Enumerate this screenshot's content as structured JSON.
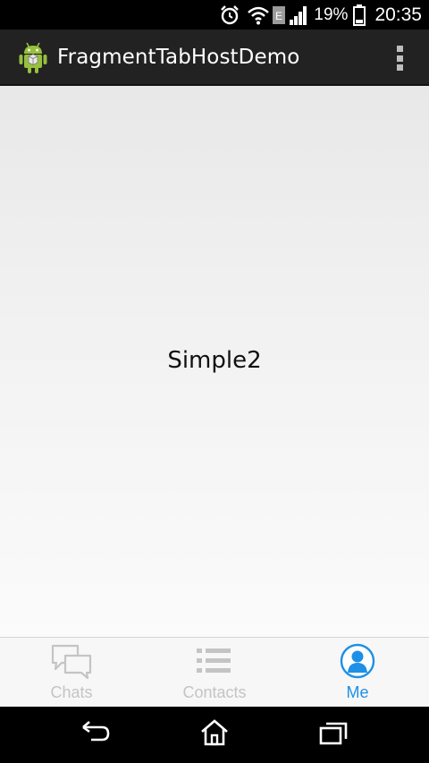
{
  "status_bar": {
    "battery_percent": "19%",
    "time": "20:35",
    "network_badge": "E",
    "icons": [
      "alarm-icon",
      "wifi-icon",
      "edge-network-icon",
      "signal-icon",
      "battery-icon"
    ]
  },
  "action_bar": {
    "title": "FragmentTabHostDemo",
    "app_icon": "android-icon",
    "overflow_icon": "overflow-menu-icon"
  },
  "content": {
    "text": "Simple2"
  },
  "tabs": [
    {
      "label": "Chats",
      "icon": "chat-bubbles-icon",
      "selected": false
    },
    {
      "label": "Contacts",
      "icon": "list-icon",
      "selected": false
    },
    {
      "label": "Me",
      "icon": "person-icon",
      "selected": true
    }
  ],
  "colors": {
    "tab_selected": "#1e90e6",
    "tab_unselected": "#c4c4c4",
    "action_bar": "#222222",
    "android_green": "#97c03d"
  },
  "nav_bar": {
    "icons": [
      "back-icon",
      "home-icon",
      "recents-icon"
    ]
  }
}
